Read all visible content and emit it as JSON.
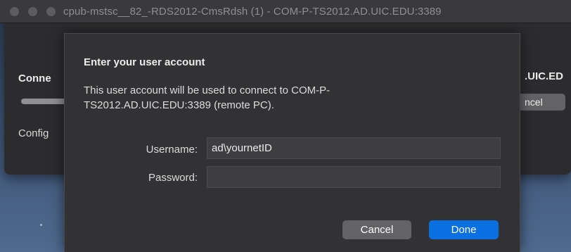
{
  "window": {
    "title": "cpub-mstsc__82_-RDS2012-CmsRdsh (1) - COM-P-TS2012.AD.UIC.EDU:3389"
  },
  "background_window": {
    "connecting_label": "Conne",
    "configuring_label": "Config",
    "host_fragment": ".UIC.ED",
    "cancel_fragment": "ncel"
  },
  "dialog": {
    "title": "Enter your user account",
    "message": "This user account will be used to connect to COM-P-TS2012.AD.UIC.EDU:3389 (remote PC).",
    "username_label": "Username:",
    "username_value": "ad\\yournetID",
    "password_label": "Password:",
    "password_value": "",
    "cancel_label": "Cancel",
    "done_label": "Done"
  },
  "colors": {
    "accent": "#0a6fe0",
    "sheet_background": "#323234",
    "titlebar": "#3a3a3c"
  }
}
